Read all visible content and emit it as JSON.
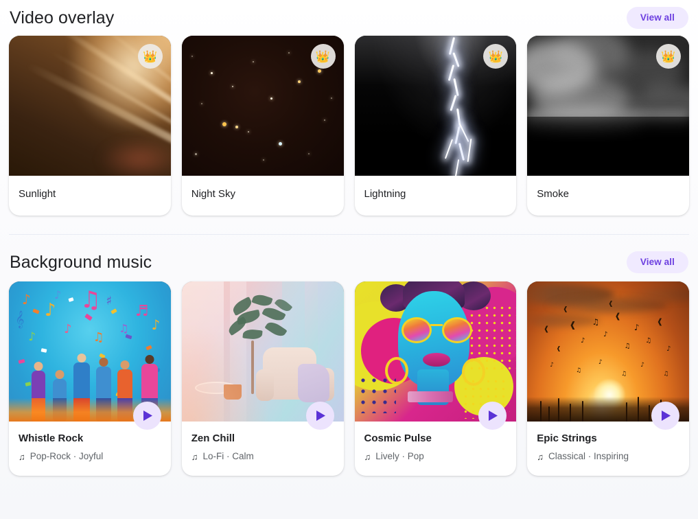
{
  "sections": [
    {
      "id": "video-overlay",
      "title": "Video overlay",
      "view_all_label": "View all",
      "cards": [
        {
          "title": "Sunlight",
          "badge_icon": "crown-icon",
          "badge_glyph": "👑"
        },
        {
          "title": "Night Sky",
          "badge_icon": "crown-icon",
          "badge_glyph": "👑"
        },
        {
          "title": "Lightning",
          "badge_icon": "crown-icon",
          "badge_glyph": "👑"
        },
        {
          "title": "Smoke",
          "badge_icon": "crown-icon",
          "badge_glyph": "👑"
        }
      ]
    },
    {
      "id": "background-music",
      "title": "Background music",
      "view_all_label": "View all",
      "cards": [
        {
          "title": "Whistle Rock",
          "genre": "Pop-Rock",
          "mood": "Joyful",
          "subtitle": "Pop-Rock · Joyful",
          "note_icon": "music-note-icon",
          "note_glyph": "♫",
          "play_icon": "play-icon"
        },
        {
          "title": "Zen Chill",
          "genre": "Lo-Fi",
          "mood": "Calm",
          "subtitle": "Lo-Fi · Calm",
          "note_icon": "music-note-icon",
          "note_glyph": "♫",
          "play_icon": "play-icon"
        },
        {
          "title": "Cosmic Pulse",
          "genre": "Lively",
          "mood": "Pop",
          "subtitle": "Lively · Pop",
          "note_icon": "music-note-icon",
          "note_glyph": "♫",
          "play_icon": "play-icon"
        },
        {
          "title": "Epic Strings",
          "genre": "Classical",
          "mood": "Inspiring",
          "subtitle": "Classical · Inspiring",
          "note_icon": "music-note-icon",
          "note_glyph": "♫",
          "play_icon": "play-icon"
        }
      ]
    }
  ],
  "colors": {
    "accent": "#6c3fe0",
    "chip_background": "#f0eaff",
    "play_background": "#ece3fd",
    "title": "#202124",
    "subtitle": "#5f6368",
    "divider": "#e8ecf4",
    "page_background": "#ffffff"
  }
}
